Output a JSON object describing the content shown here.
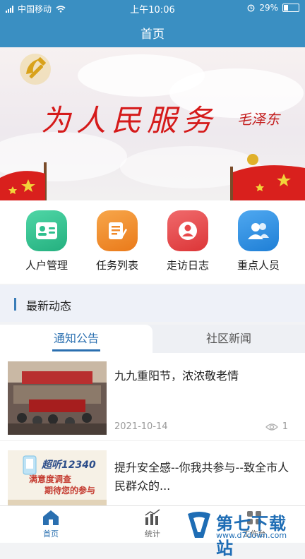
{
  "status_bar": {
    "carrier": "中国移动",
    "time": "上午10:06",
    "battery": "29%"
  },
  "nav": {
    "title": "首页"
  },
  "banner": {
    "slogan": "为人民服务",
    "signature": "毛泽东"
  },
  "quick_menu": [
    {
      "label": "人户管理",
      "icon": "id-card-icon",
      "color": "#2fbf8e"
    },
    {
      "label": "任务列表",
      "icon": "task-list-icon",
      "color": "#f08a2a"
    },
    {
      "label": "走访日志",
      "icon": "visit-log-icon",
      "color": "#e8484a"
    },
    {
      "label": "重点人员",
      "icon": "people-icon",
      "color": "#2a8ee0"
    }
  ],
  "section": {
    "title": "最新动态"
  },
  "tabs": [
    {
      "label": "通知公告",
      "active": true
    },
    {
      "label": "社区新闻",
      "active": false
    }
  ],
  "news": [
    {
      "title": "九九重阳节，浓浓敬老情",
      "date": "2021-10-14",
      "views": "1"
    },
    {
      "title": "提升安全感--你我共参与--致全市人民群众的...",
      "thumb_text_1": "超听12340",
      "thumb_text_2": "满意度调查",
      "thumb_text_3": "期待您的参与"
    }
  ],
  "tabbar": [
    {
      "label": "首页",
      "active": true
    },
    {
      "label": "统计",
      "active": false
    },
    {
      "label": "工作台",
      "active": false
    }
  ],
  "watermark": {
    "name": "第七下载站",
    "url": "www.d7down.com"
  },
  "colors": {
    "primary": "#3a8fc2",
    "accent": "#2a6fb0",
    "party_red": "#d51a1a"
  }
}
